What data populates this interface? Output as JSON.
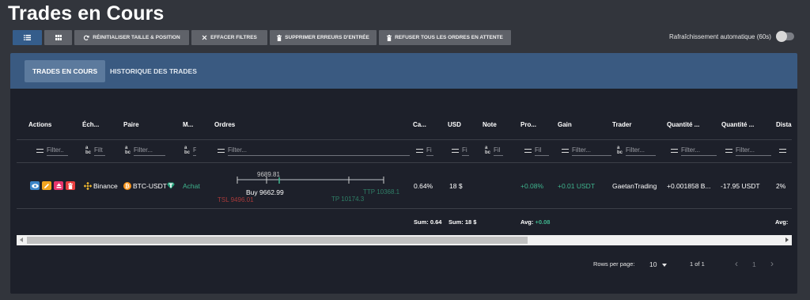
{
  "page": {
    "title": "Trades en Cours"
  },
  "toolbar": {
    "reset_label": "RÉINITIALISER TAILLE & POSITION",
    "clear_filters_label": "EFFACER FILTRES",
    "delete_errors_label": "SUPPRIMER ERREURS D'ENTRÉE",
    "reject_orders_label": "REFUSER TOUS LES ORDRES EN ATTENTE"
  },
  "auto_refresh": {
    "label": "Rafraîchissement automatique (60s)",
    "enabled": false
  },
  "tabs": [
    {
      "label": "TRADES EN COURS",
      "active": true
    },
    {
      "label": "HISTORIQUE DES TRADES",
      "active": false
    }
  ],
  "table": {
    "columns": [
      "Actions",
      "Éch...",
      "Paire",
      "M...",
      "Ordres",
      "Ca...",
      "USD",
      "Note",
      "Pro...",
      "Gain",
      "Trader",
      "Quantité ...",
      "Quantité ...",
      "Dista"
    ],
    "filters": {
      "exchange": "Filt",
      "pair": "Filter...",
      "market": "F",
      "orders": "Filter...",
      "capital": "Fi",
      "usd": "Fi",
      "note": "Fil",
      "profit": "Fil",
      "gain": "Filter...",
      "trader": "Filter...",
      "qty1": "Filter...",
      "qty2": "Filter...",
      "first": "Filter.."
    },
    "row": {
      "exchange": "Binance",
      "pair": "BTC-USDT",
      "market": "Achat",
      "orders": {
        "current": "9689.81",
        "buy": "Buy 9662.99",
        "tsl": "TSL 9496.01",
        "tp": "TP 10174.3",
        "ttp": "TTP 10368.1"
      },
      "capital": "0.64%",
      "usd": "18 $",
      "profit": "+0.08%",
      "gain": "+0.01 USDT",
      "trader": "GaetanTrading",
      "qty1": "+0.001858 B...",
      "qty2": "-17.95 USDT",
      "distance": "2%"
    },
    "summary": {
      "capital_sum_label": "Sum:",
      "capital_sum": "0.64",
      "usd_sum_label": "Sum:",
      "usd_sum": "18 $",
      "profit_avg_label": "Avg:",
      "profit_avg": "+0.08",
      "dist_avg_label": "Avg:"
    }
  },
  "pagination": {
    "rows_per_page_label": "Rows per page:",
    "rows_per_page": "10",
    "range": "1 of 1",
    "current_page": "1"
  },
  "colors": {
    "accent": "#355d8b",
    "header_bar": "#3a5a81",
    "positive": "#3fb58e",
    "negative": "#b13b3b",
    "binance": "#f3ba2f",
    "btc": "#f7931a"
  }
}
